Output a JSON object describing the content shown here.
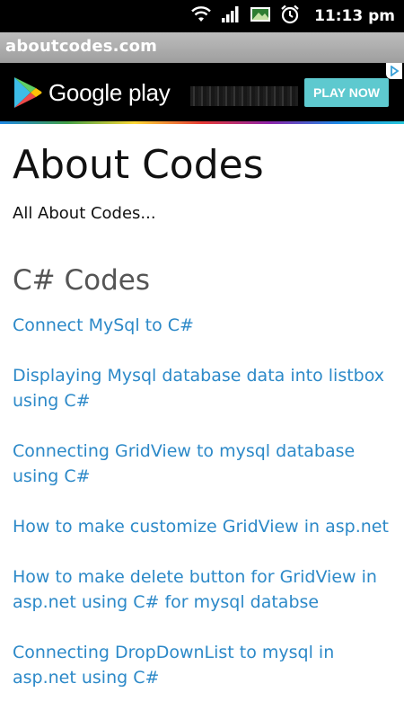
{
  "status_bar": {
    "time": "11:13 pm",
    "icons": [
      "wifi-icon",
      "signal-icon",
      "image-notification-icon",
      "alarm-icon"
    ]
  },
  "browser": {
    "url": "aboutcodes.com"
  },
  "ad": {
    "brand": "Google play",
    "cta": "PLAY NOW",
    "icons": [
      "google-play-logo",
      "adchoices-icon"
    ]
  },
  "page": {
    "title": "About Codes",
    "tagline": "All About Codes...",
    "section_heading": "C# Codes",
    "links": [
      "Connect MySql to C#",
      "Displaying Mysql database data into listbox using C#",
      "Connecting GridView to mysql database using C#",
      "How to make customize GridView in asp.net",
      "How to make delete button for GridView in asp.net using C# for mysql databse",
      "Connecting DropDownList to mysql in asp.net using C#"
    ]
  },
  "colors": {
    "link": "#2c89c8",
    "heading_gray": "#555555",
    "play_button": "#5ec9cf"
  }
}
